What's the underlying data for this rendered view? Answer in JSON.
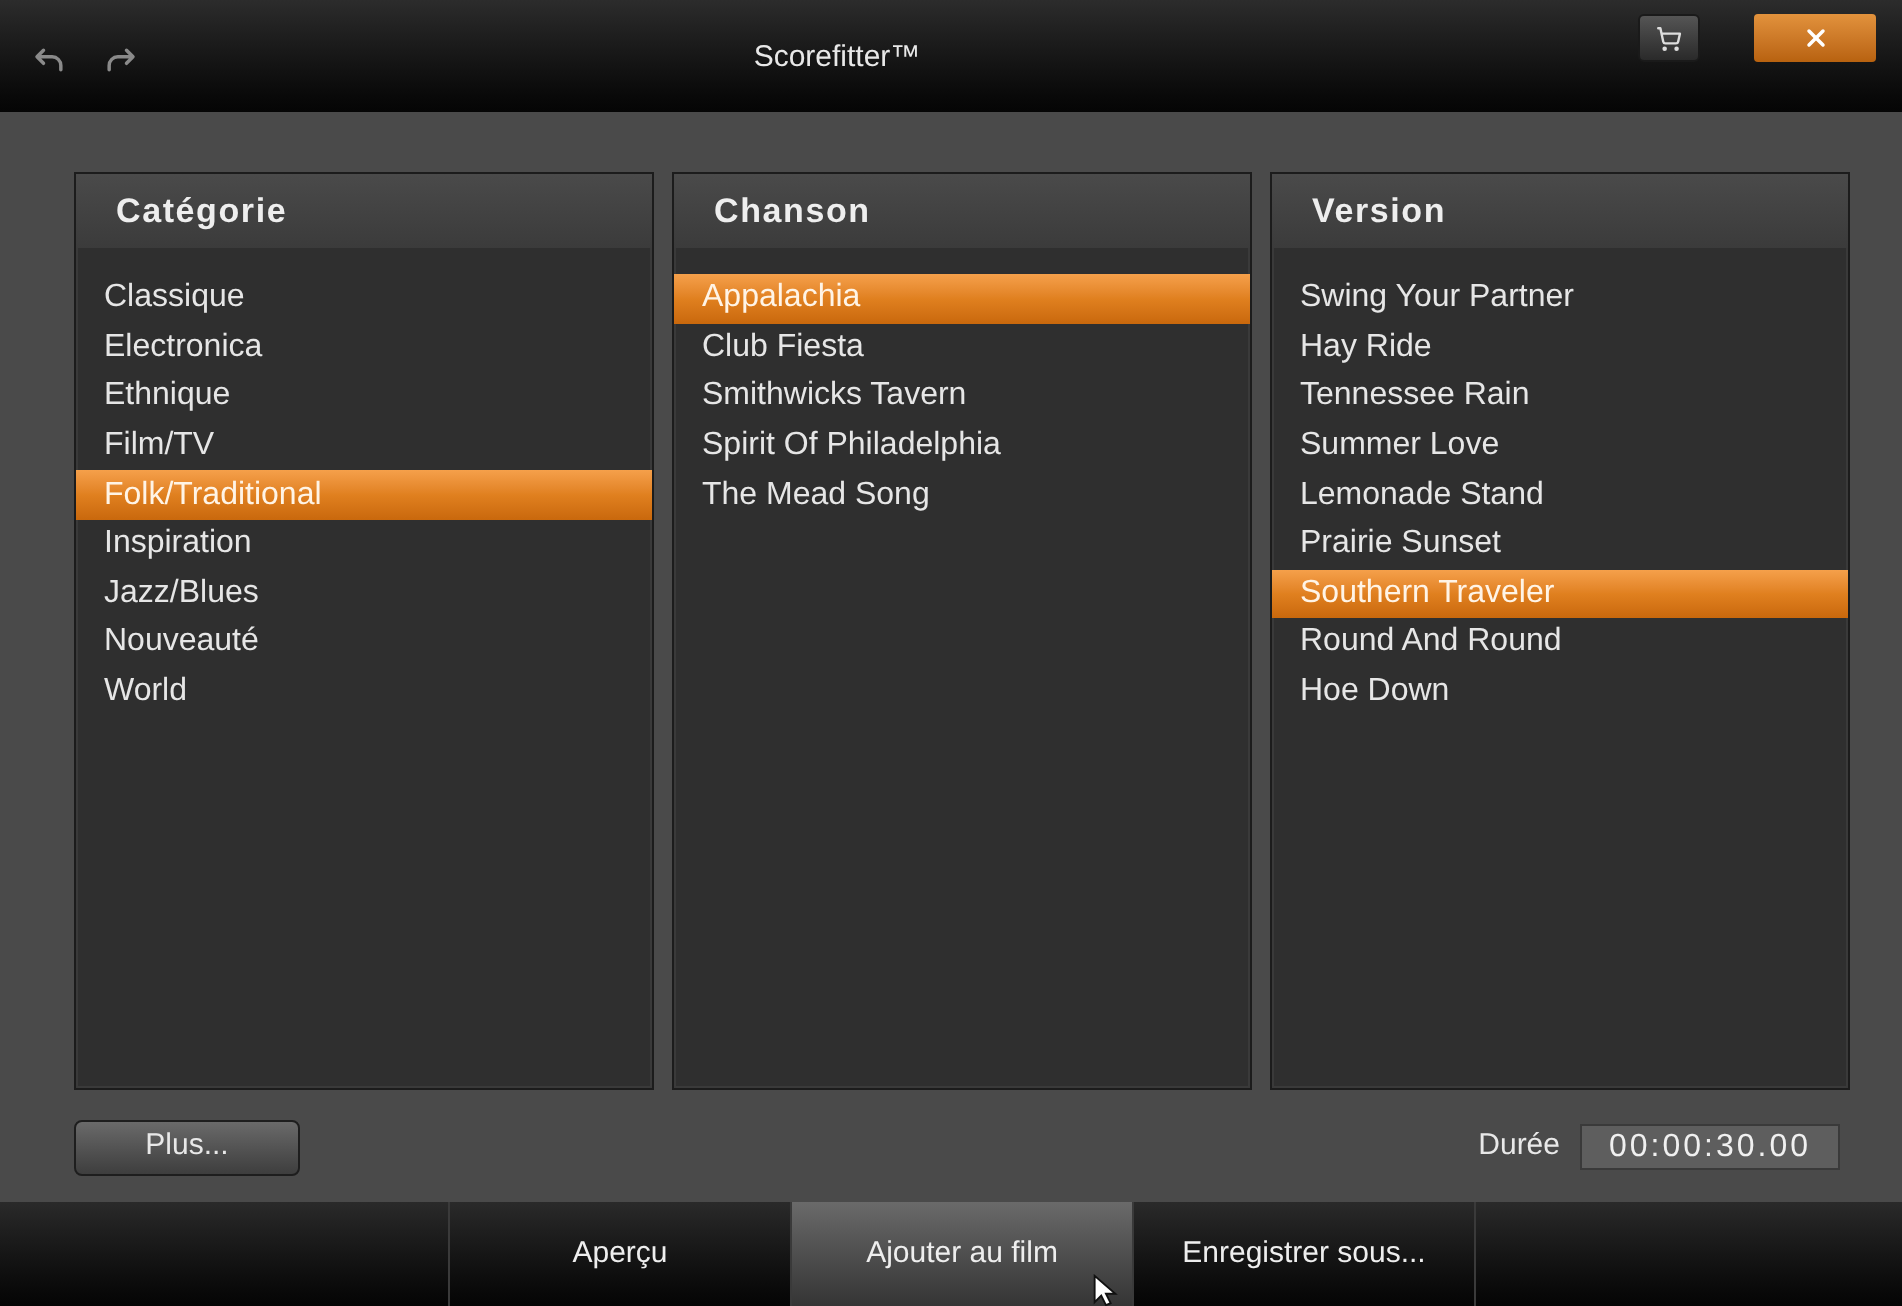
{
  "window": {
    "title": "Scorefitter™"
  },
  "columns": [
    {
      "heading": "Catégorie",
      "items": [
        {
          "label": "Classique",
          "selected": false
        },
        {
          "label": "Electronica",
          "selected": false
        },
        {
          "label": "Ethnique",
          "selected": false
        },
        {
          "label": "Film/TV",
          "selected": false
        },
        {
          "label": "Folk/Traditional",
          "selected": true
        },
        {
          "label": "Inspiration",
          "selected": false
        },
        {
          "label": "Jazz/Blues",
          "selected": false
        },
        {
          "label": "Nouveauté",
          "selected": false
        },
        {
          "label": "World",
          "selected": false
        }
      ]
    },
    {
      "heading": "Chanson",
      "items": [
        {
          "label": "Appalachia",
          "selected": true
        },
        {
          "label": "Club Fiesta",
          "selected": false
        },
        {
          "label": "Smithwicks Tavern",
          "selected": false
        },
        {
          "label": "Spirit Of Philadelphia",
          "selected": false
        },
        {
          "label": "The Mead Song",
          "selected": false
        }
      ]
    },
    {
      "heading": "Version",
      "items": [
        {
          "label": "Swing Your Partner",
          "selected": false
        },
        {
          "label": "Hay Ride",
          "selected": false
        },
        {
          "label": "Tennessee Rain",
          "selected": false
        },
        {
          "label": "Summer Love",
          "selected": false
        },
        {
          "label": "Lemonade Stand",
          "selected": false
        },
        {
          "label": "Prairie Sunset",
          "selected": false
        },
        {
          "label": "Southern Traveler",
          "selected": true
        },
        {
          "label": "Round And Round",
          "selected": false
        },
        {
          "label": "Hoe Down",
          "selected": false
        }
      ]
    }
  ],
  "more_button": {
    "label": "Plus..."
  },
  "duration": {
    "label": "Durée",
    "value": "00:00:30.00"
  },
  "bottom_bar": {
    "buttons": [
      {
        "label": "Aperçu",
        "hovered": false
      },
      {
        "label": "Ajouter au film",
        "hovered": true
      },
      {
        "label": "Enregistrer sous...",
        "hovered": false
      }
    ]
  }
}
